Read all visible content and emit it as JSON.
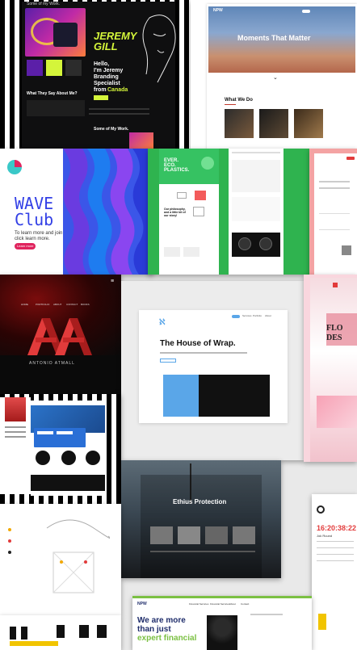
{
  "jeremy": {
    "tagline": "Some of my Work.",
    "name_line1": "JEREMY",
    "name_line2": "GILL",
    "hello": "Hello,",
    "im": "I'm Jeremy",
    "role1": "Branding",
    "role2": "Specialist",
    "from": "from",
    "city": "Canada",
    "about": "What They Say About Me?",
    "work": "Some of My Work.",
    "accent": "#d4f53a"
  },
  "npw_top": {
    "logo": "NPW",
    "hero": "Moments That Matter",
    "what_we_do": "What We Do"
  },
  "wave": {
    "title1": "WAVE",
    "title2": "Club",
    "body1": "To learn more and join",
    "body2": "click learn more.",
    "button": "Learn more",
    "accent": "#e0245e"
  },
  "eco": {
    "line1": "EVER.",
    "line2": "ECO.",
    "line3": "PLASTICS.",
    "headline1": "Our philosophy,",
    "headline2": "and a little bit of",
    "headline3": "our story!"
  },
  "antonio": {
    "name": "ANTONIO ATMALL",
    "menu": [
      "HOME",
      "PORTFOLIO",
      "ABOUT",
      "CONTACT",
      "BOOKS"
    ]
  },
  "wrap": {
    "headline": "The House of Wrap.",
    "nav": [
      "Home",
      "Services",
      "Portfolio",
      "About",
      "Contact"
    ],
    "accent": "#5aa6e8"
  },
  "flor": {
    "line1": "FLO",
    "line2": "DES"
  },
  "ethius": {
    "title": "Ethius Protection"
  },
  "clock": {
    "time": "16:20:38:22",
    "sub": "Jok Ruund"
  },
  "npw_bottom": {
    "logo": "NPW",
    "nav": [
      "Financial Services",
      "Financial Services",
      "About",
      "Contact"
    ],
    "line1": "We are more",
    "line2": "than just",
    "line3": "expert financial"
  }
}
